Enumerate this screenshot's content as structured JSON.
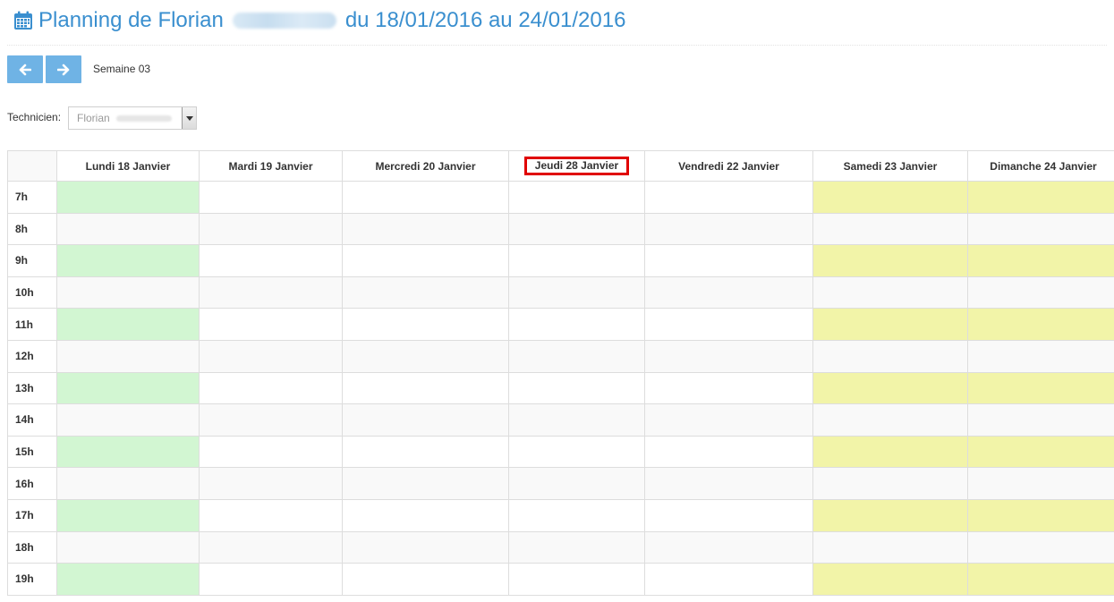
{
  "header": {
    "title_prefix": "Planning de Florian",
    "title_suffix": "du 18/01/2016 au 24/01/2016",
    "calendar_icon": "calendar-icon"
  },
  "nav": {
    "prev_icon": "arrow-left-icon",
    "next_icon": "arrow-right-icon",
    "week_label": "Semaine 03"
  },
  "filter": {
    "label": "Technicien:",
    "value": "Florian"
  },
  "planning": {
    "days": [
      "Lundi 18 Janvier",
      "Mardi 19 Janvier",
      "Mercredi 20 Janvier",
      "Jeudi 28 Janvier",
      "Vendredi 22 Janvier",
      "Samedi 23 Janvier",
      "Dimanche 24 Janvier"
    ],
    "hours": [
      "7h",
      "8h",
      "9h",
      "10h",
      "11h",
      "12h",
      "13h",
      "14h",
      "15h",
      "16h",
      "17h",
      "18h",
      "19h"
    ],
    "highlighted_day_index": 3,
    "colors": {
      "available": "#d2f6d2",
      "weekend": "#f2f4a8",
      "highlight_border": "#e00000",
      "accent": "#3a8fcf"
    }
  }
}
